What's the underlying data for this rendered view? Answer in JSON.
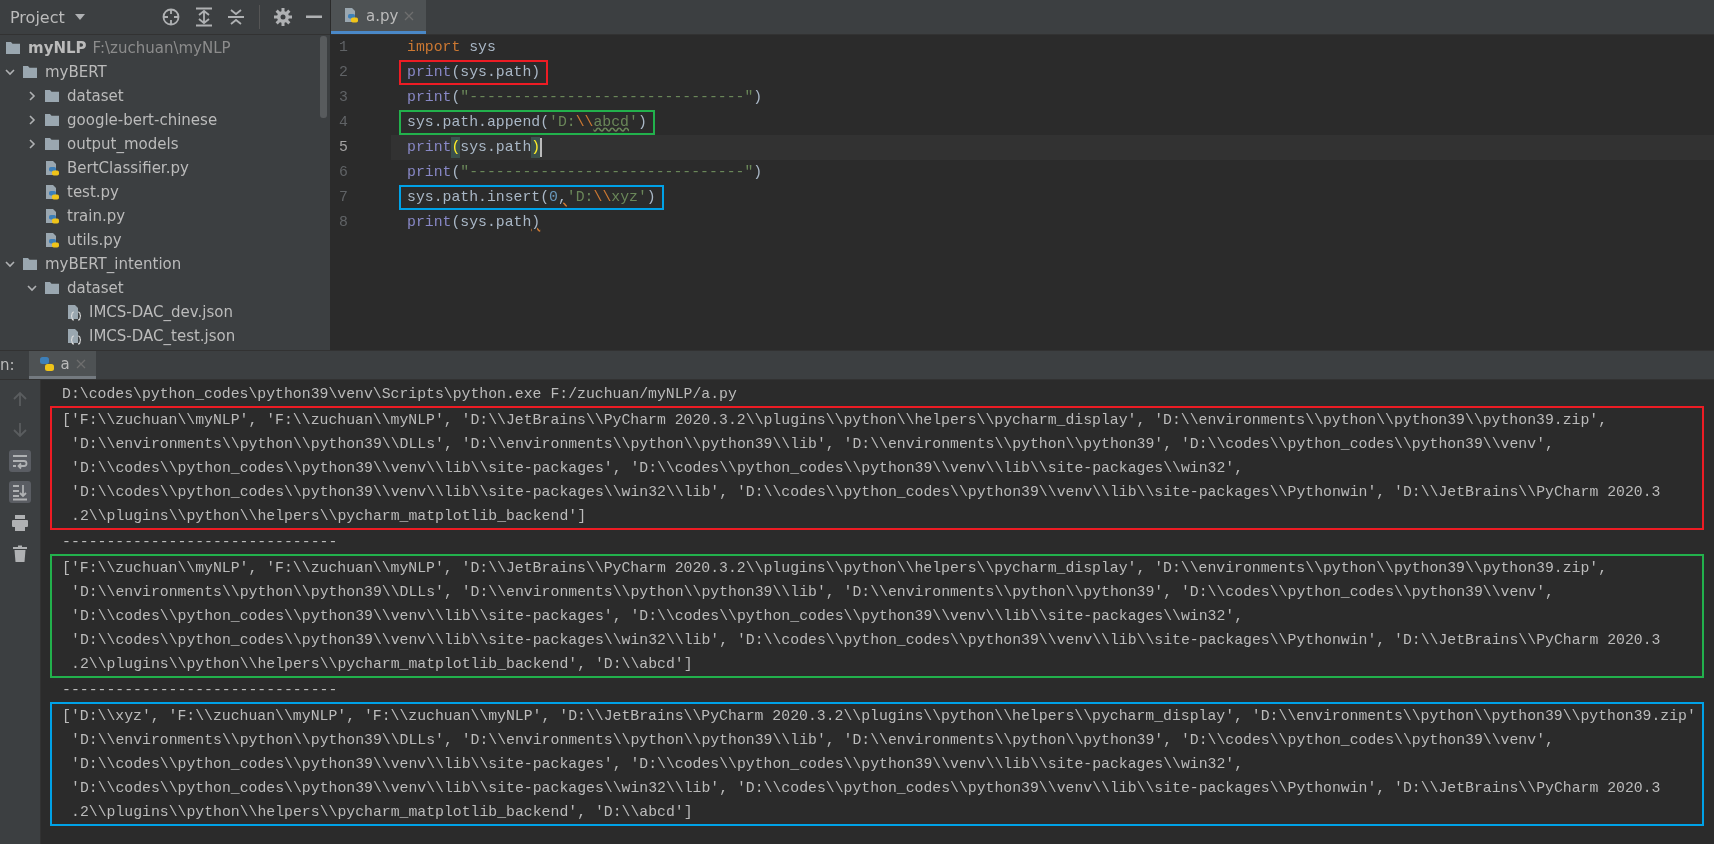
{
  "project_panel": {
    "title": "Project",
    "root": {
      "name": "myNLP",
      "path": "F:\\zuchuan\\myNLP",
      "children": [
        {
          "name": "myBERT",
          "kind": "folder",
          "expanded": true,
          "children": [
            {
              "name": "dataset",
              "kind": "folder",
              "expanded": false
            },
            {
              "name": "google-bert-chinese",
              "kind": "folder",
              "expanded": false
            },
            {
              "name": "output_models",
              "kind": "folder",
              "expanded": false
            },
            {
              "name": "BertClassifier.py",
              "kind": "python"
            },
            {
              "name": "test.py",
              "kind": "python"
            },
            {
              "name": "train.py",
              "kind": "python"
            },
            {
              "name": "utils.py",
              "kind": "python"
            }
          ]
        },
        {
          "name": "myBERT_intention",
          "kind": "folder",
          "expanded": true,
          "children": [
            {
              "name": "dataset",
              "kind": "folder",
              "expanded": true,
              "children": [
                {
                  "name": "IMCS-DAC_dev.json",
                  "kind": "json"
                },
                {
                  "name": "IMCS-DAC_test.json",
                  "kind": "json"
                }
              ]
            }
          ]
        }
      ]
    }
  },
  "editor": {
    "tabs": [
      {
        "label": "a.py",
        "selected": true
      }
    ],
    "lines": [
      {
        "number": "1",
        "current": false,
        "tokens": [
          {
            "kind": "keyword",
            "text": "import"
          },
          {
            "kind": "plain",
            "text": " sys"
          }
        ]
      },
      {
        "number": "2",
        "current": false,
        "color": "#ed1c24",
        "tokens": [
          {
            "kind": "builtin",
            "text": "print"
          },
          {
            "kind": "plain",
            "text": "(sys.path)"
          }
        ]
      },
      {
        "number": "3",
        "current": false,
        "tokens": [
          {
            "kind": "builtin",
            "text": "print"
          },
          {
            "kind": "plain",
            "text": "("
          },
          {
            "kind": "string",
            "text": "\"-------------------------------\""
          },
          {
            "kind": "plain",
            "text": ")"
          }
        ]
      },
      {
        "number": "4",
        "current": false,
        "color": "#22b14c",
        "tokens": [
          {
            "kind": "plain",
            "text": "sys.path.append("
          },
          {
            "kind": "string",
            "text": "'D:"
          },
          {
            "kind": "escape",
            "text": "\\\\"
          },
          {
            "kind": "string-typo",
            "text": "abcd"
          },
          {
            "kind": "string",
            "text": "'"
          },
          {
            "kind": "plain",
            "text": ")"
          }
        ]
      },
      {
        "number": "5",
        "current": true,
        "tokens": [
          {
            "kind": "builtin",
            "text": "print"
          },
          {
            "kind": "brace-match",
            "text": "("
          },
          {
            "kind": "plain",
            "text": "sys.path"
          },
          {
            "kind": "brace-match",
            "text": ")"
          }
        ]
      },
      {
        "number": "6",
        "current": false,
        "tokens": [
          {
            "kind": "builtin",
            "text": "print"
          },
          {
            "kind": "plain",
            "text": "("
          },
          {
            "kind": "string",
            "text": "\"-------------------------------\""
          },
          {
            "kind": "plain",
            "text": ")"
          }
        ]
      },
      {
        "number": "7",
        "current": false,
        "color": "#00a2e8",
        "tokens": [
          {
            "kind": "plain",
            "text": "sys.path.insert("
          },
          {
            "kind": "number",
            "text": "0"
          },
          {
            "kind": "punct-warn",
            "text": ","
          },
          {
            "kind": "string",
            "text": "'D:"
          },
          {
            "kind": "escape",
            "text": "\\\\"
          },
          {
            "kind": "string",
            "text": "xyz'"
          },
          {
            "kind": "plain",
            "text": ")"
          }
        ]
      },
      {
        "number": "8",
        "current": false,
        "tokens": [
          {
            "kind": "builtin",
            "text": "print"
          },
          {
            "kind": "plain",
            "text": "(sys.path"
          },
          {
            "kind": "punct-warn",
            "text": ")"
          }
        ]
      }
    ]
  },
  "run_panel": {
    "label": "n:",
    "tabs": [
      {
        "label": "a",
        "selected": true
      }
    ],
    "toolbar": [
      {
        "kind": "up",
        "on": false,
        "disabled": true
      },
      {
        "kind": "down",
        "on": false,
        "disabled": true
      },
      {
        "kind": "wrap",
        "on": true,
        "disabled": false
      },
      {
        "kind": "scroll-end",
        "on": true,
        "disabled": false
      },
      {
        "kind": "print",
        "on": false,
        "disabled": false
      },
      {
        "kind": "delete",
        "on": false,
        "disabled": false
      }
    ],
    "console": [
      {
        "kind": "text",
        "text": "D:\\codes\\python_codes\\python39\\venv\\Scripts\\python.exe F:/zuchuan/myNLP/a.py"
      },
      {
        "kind": "output",
        "color": "#ed1c24",
        "lines": [
          "['F:\\\\zuchuan\\\\myNLP', 'F:\\\\zuchuan\\\\myNLP', 'D:\\\\JetBrains\\\\PyCharm 2020.3.2\\\\plugins\\\\python\\\\helpers\\\\pycharm_display', 'D:\\\\environments\\\\python\\\\python39\\\\python39.zip',",
          "'D:\\\\environments\\\\python\\\\python39\\\\DLLs', 'D:\\\\environments\\\\python\\\\python39\\\\lib', 'D:\\\\environments\\\\python\\\\python39', 'D:\\\\codes\\\\python_codes\\\\python39\\\\venv',",
          "'D:\\\\codes\\\\python_codes\\\\python39\\\\venv\\\\lib\\\\site-packages', 'D:\\\\codes\\\\python_codes\\\\python39\\\\venv\\\\lib\\\\site-packages\\\\win32',",
          "'D:\\\\codes\\\\python_codes\\\\python39\\\\venv\\\\lib\\\\site-packages\\\\win32\\\\lib', 'D:\\\\codes\\\\python_codes\\\\python39\\\\venv\\\\lib\\\\site-packages\\\\Pythonwin', 'D:\\\\JetBrains\\\\PyCharm 2020.3",
          ".2\\\\plugins\\\\python\\\\helpers\\\\pycharm_matplotlib_backend']"
        ]
      },
      {
        "kind": "text",
        "text": "-------------------------------"
      },
      {
        "kind": "output",
        "color": "#22b14c",
        "lines": [
          "['F:\\\\zuchuan\\\\myNLP', 'F:\\\\zuchuan\\\\myNLP', 'D:\\\\JetBrains\\\\PyCharm 2020.3.2\\\\plugins\\\\python\\\\helpers\\\\pycharm_display', 'D:\\\\environments\\\\python\\\\python39\\\\python39.zip',",
          "'D:\\\\environments\\\\python\\\\python39\\\\DLLs', 'D:\\\\environments\\\\python\\\\python39\\\\lib', 'D:\\\\environments\\\\python\\\\python39', 'D:\\\\codes\\\\python_codes\\\\python39\\\\venv',",
          "'D:\\\\codes\\\\python_codes\\\\python39\\\\venv\\\\lib\\\\site-packages', 'D:\\\\codes\\\\python_codes\\\\python39\\\\venv\\\\lib\\\\site-packages\\\\win32',",
          "'D:\\\\codes\\\\python_codes\\\\python39\\\\venv\\\\lib\\\\site-packages\\\\win32\\\\lib', 'D:\\\\codes\\\\python_codes\\\\python39\\\\venv\\\\lib\\\\site-packages\\\\Pythonwin', 'D:\\\\JetBrains\\\\PyCharm 2020.3",
          ".2\\\\plugins\\\\python\\\\helpers\\\\pycharm_matplotlib_backend', 'D:\\\\abcd']"
        ]
      },
      {
        "kind": "text",
        "text": "-------------------------------"
      },
      {
        "kind": "output",
        "color": "#00a2e8",
        "lines": [
          "['D:\\\\xyz', 'F:\\\\zuchuan\\\\myNLP', 'F:\\\\zuchuan\\\\myNLP', 'D:\\\\JetBrains\\\\PyCharm 2020.3.2\\\\plugins\\\\python\\\\helpers\\\\pycharm_display', 'D:\\\\environments\\\\python\\\\python39\\\\python39.zip'",
          "'D:\\\\environments\\\\python\\\\python39\\\\DLLs', 'D:\\\\environments\\\\python\\\\python39\\\\lib', 'D:\\\\environments\\\\python\\\\python39', 'D:\\\\codes\\\\python_codes\\\\python39\\\\venv',",
          "'D:\\\\codes\\\\python_codes\\\\python39\\\\venv\\\\lib\\\\site-packages', 'D:\\\\codes\\\\python_codes\\\\python39\\\\venv\\\\lib\\\\site-packages\\\\win32',",
          "'D:\\\\codes\\\\python_codes\\\\python39\\\\venv\\\\lib\\\\site-packages\\\\win32\\\\lib', 'D:\\\\codes\\\\python_codes\\\\python39\\\\venv\\\\lib\\\\site-packages\\\\Pythonwin', 'D:\\\\JetBrains\\\\PyCharm 2020.3",
          ".2\\\\plugins\\\\python\\\\helpers\\\\pycharm_matplotlib_backend', 'D:\\\\abcd']"
        ]
      }
    ]
  }
}
